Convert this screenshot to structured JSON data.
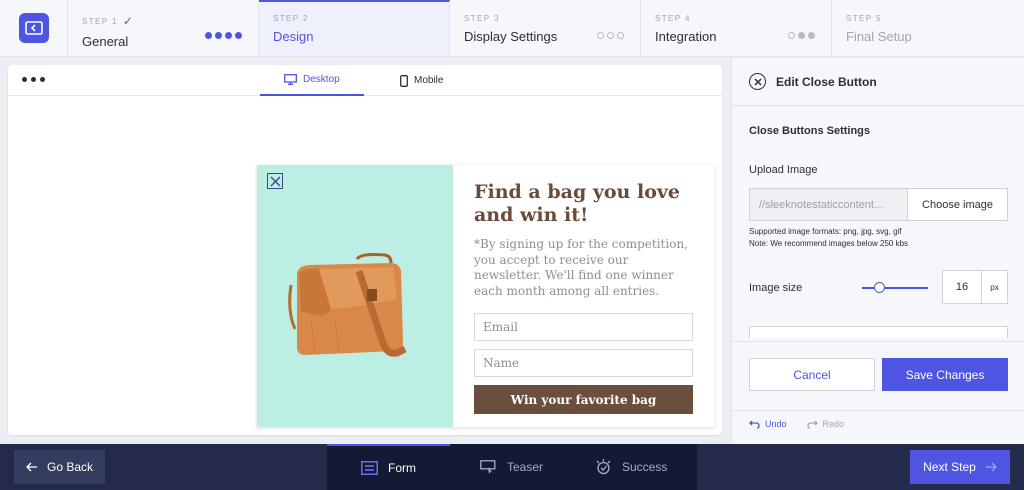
{
  "steps": [
    {
      "label": "STEP 1",
      "name": "General",
      "check": "✓",
      "state": "done"
    },
    {
      "label": "STEP 2",
      "name": "Design",
      "state": "active"
    },
    {
      "label": "STEP 3",
      "name": "Display Settings",
      "state": "pending"
    },
    {
      "label": "STEP 4",
      "name": "Integration",
      "state": "pending"
    },
    {
      "label": "STEP 5",
      "name": "Final Setup",
      "state": "muted"
    }
  ],
  "preview": {
    "tabs": {
      "desktop": "Desktop",
      "mobile": "Mobile"
    },
    "popup": {
      "title": "Find a bag you love and win it!",
      "text": "*By signing up for the competition, you accept to receive our newsletter. We'll find one winner each month among all entries.",
      "email_placeholder": "Email",
      "name_placeholder": "Name",
      "button": "Win your favorite bag"
    }
  },
  "panel": {
    "title": "Edit Close Button",
    "section": "Close Buttons Settings",
    "upload_label": "Upload Image",
    "upload_path": "//sleeknotestaticcontent...",
    "choose_button": "Choose image",
    "hint_formats": "Supported image formats: png, jpg, svg, gif",
    "hint_size": "Note: We recommend images below 250 kbs",
    "image_size_label": "Image size",
    "image_size_value": "16",
    "image_size_unit": "px",
    "cancel": "Cancel",
    "save": "Save Changes",
    "undo": "Undo",
    "redo": "Redo"
  },
  "bottom": {
    "go_back": "Go Back",
    "tabs": {
      "form": "Form",
      "teaser": "Teaser",
      "success": "Success"
    },
    "next_step": "Next Step"
  },
  "colors": {
    "accent": "#4f55e3",
    "dark": "#232a4a",
    "popup_bg": "#bdeee3",
    "brown": "#6b4e3e"
  }
}
